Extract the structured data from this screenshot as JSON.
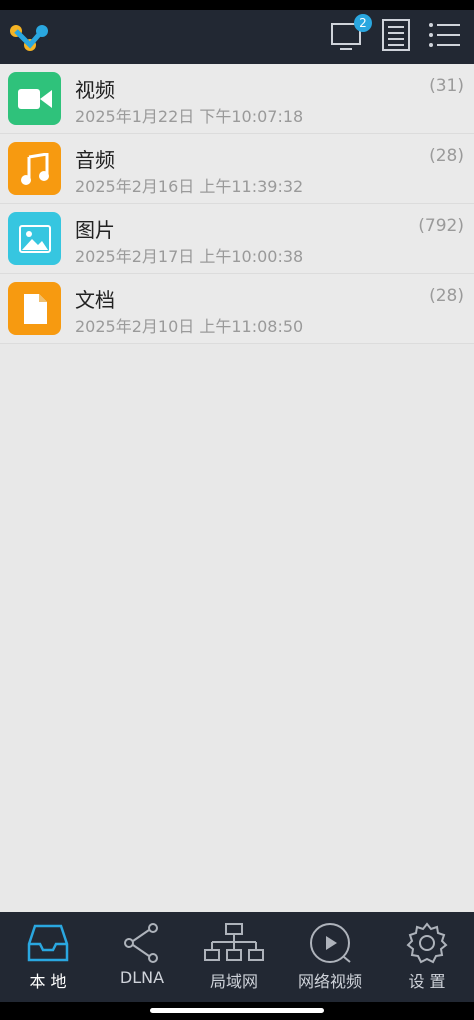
{
  "header": {
    "logo_icon": "app-logo",
    "cast_badge": "2"
  },
  "list": [
    {
      "title": "视频",
      "date": "2025年1月22日 下午10:07:18",
      "count": "(31)",
      "icon": "video-camera-icon",
      "color": "#2fc27b"
    },
    {
      "title": "音频",
      "date": "2025年2月16日 上午11:39:32",
      "count": "(28)",
      "icon": "music-note-icon",
      "color": "#f79a10"
    },
    {
      "title": "图片",
      "date": "2025年2月17日 上午10:00:38",
      "count": "(792)",
      "icon": "image-icon",
      "color": "#36c6e0"
    },
    {
      "title": "文档",
      "date": "2025年2月10日 上午11:08:50",
      "count": "(28)",
      "icon": "document-icon",
      "color": "#f79a10"
    }
  ],
  "tabs": [
    {
      "label": "本 地",
      "icon": "inbox-icon",
      "active": true
    },
    {
      "label": "DLNA",
      "icon": "share-icon",
      "active": false
    },
    {
      "label": "局域网",
      "icon": "network-icon",
      "active": false
    },
    {
      "label": "网络视频",
      "icon": "play-circle-icon",
      "active": false
    },
    {
      "label": "设 置",
      "icon": "gear-icon",
      "active": false
    }
  ],
  "colors": {
    "topbar": "#222833",
    "accent": "#2aa7e0",
    "background": "#e8e8e8"
  }
}
